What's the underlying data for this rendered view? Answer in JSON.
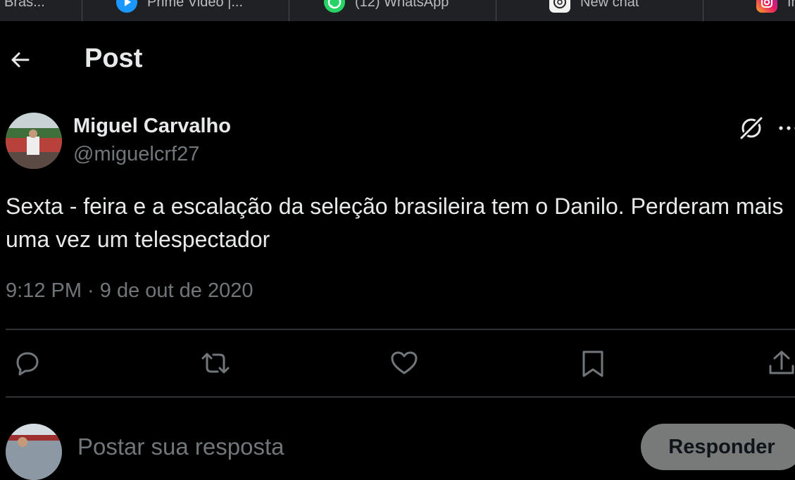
{
  "browser_tabs": [
    {
      "label": "Bras...",
      "icon": "tab-favicon"
    },
    {
      "label": "Prime Video |...",
      "icon": "play-icon"
    },
    {
      "label": "(12) WhatsApp",
      "icon": "whatsapp-icon"
    },
    {
      "label": "New chat",
      "icon": "chatgpt-icon"
    },
    {
      "label": "In",
      "icon": "instagram-icon"
    }
  ],
  "header": {
    "title": "Post",
    "back_icon": "arrow-left-icon"
  },
  "post": {
    "author_name": "Miguel Carvalho",
    "author_handle": "@miguelcrf27",
    "text": "Sexta - feira e a escalação da seleção brasileira tem o Danilo. Perderam mais uma vez um telespectador",
    "timestamp": "9:12 PM · 9 de out de 2020",
    "actions": [
      "reply-icon",
      "repost-icon",
      "like-icon",
      "bookmark-icon",
      "share-icon"
    ]
  },
  "reply": {
    "placeholder": "Postar sua resposta",
    "button_label": "Responder"
  },
  "colors": {
    "background": "#000000",
    "text_primary": "#e7e9ea",
    "text_secondary": "#71767b",
    "divider": "#2f3336",
    "tab_bar": "#202124",
    "reply_button": "#787a7a"
  }
}
